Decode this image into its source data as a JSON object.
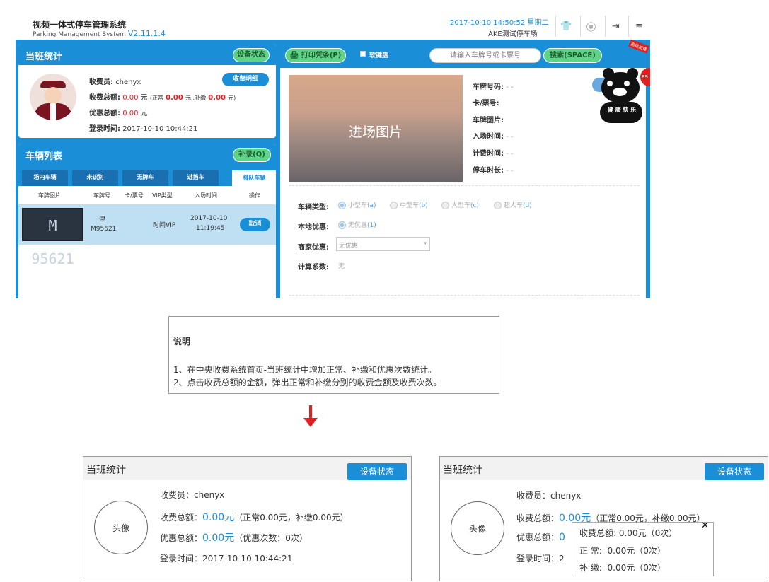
{
  "header": {
    "title": "视频一体式停车管理系统",
    "subtitle": "Parking Management System",
    "version": "V2.11.1.4",
    "datetime": "2017-10-10 14:50:52 星期二",
    "lot_name": "AKE测试停车场"
  },
  "shift_panel": {
    "title": "当班统计",
    "device_status_btn": "设备状态",
    "cashier_label": "收费员:",
    "cashier_value": "chenyx",
    "detail_btn": "收费明细",
    "total_label": "收费总额:",
    "total_value": "0.00",
    "yuan": "元",
    "normal_prefix": "(正常",
    "normal_value": "0.00",
    "normal_unit": "元 ,补缴",
    "supp_value": "0.00",
    "supp_suffix": "元)",
    "discount_label": "优惠总额:",
    "discount_value": "0.00",
    "login_label": "登录时间:",
    "login_value": "2017-10-10 10:44:21"
  },
  "vehicle_list": {
    "title": "车辆列表",
    "supplement_btn": "补录(Q)",
    "tabs": [
      "场内车辆",
      "未识别",
      "无牌车",
      "进挡车",
      "排队车辆"
    ],
    "columns": [
      "车牌图片",
      "车牌号",
      "卡/票号",
      "VIP类型",
      "入场时间",
      "操作"
    ],
    "rows": [
      {
        "plate_img_text": "M 95621",
        "plate_prov": "津",
        "plate_no": "M95621",
        "card": "",
        "vip": "时间VIP",
        "date": "2017-10-10",
        "time": "11:19:45",
        "action": "取消"
      }
    ]
  },
  "toolbar": {
    "print_btn": "打印凭条(P)",
    "soft_keyboard": "软键盘",
    "search_placeholder": "请输入车牌号或卡票号",
    "search_btn": "搜索(SPACE)",
    "corner_badge": "高级加速",
    "speed_badge": "89"
  },
  "entry": {
    "image_label": "进场图片",
    "fields": [
      {
        "label": "车牌号码:",
        "value": "- -"
      },
      {
        "label": "卡/票号:",
        "value": ""
      },
      {
        "label": "车牌图片:",
        "value": ""
      },
      {
        "label": "入场时间:",
        "value": "- -"
      },
      {
        "label": "计费时间:",
        "value": "- -"
      },
      {
        "label": "停车时长:",
        "value": "- -"
      }
    ],
    "vehicle_type_label": "车辆类型:",
    "vehicle_types": [
      {
        "name": "小型车",
        "key": "(a)"
      },
      {
        "name": "中型车",
        "key": "(b)"
      },
      {
        "name": "大型车",
        "key": "(c)"
      },
      {
        "name": "超大车",
        "key": "(d)"
      }
    ],
    "local_discount_label": "本地优惠:",
    "local_discount_option": "无优惠",
    "local_discount_key": "(1)",
    "merchant_label": "商家优惠:",
    "merchant_value": "无优惠",
    "coeff_label": "计算系数:",
    "coeff_value": "无",
    "mascot_text": "健 康 快 乐"
  },
  "note": {
    "title": "说明",
    "line1": "1、在中央收费系统首页-当班统计中增加正常、补缴和优惠次数统计。",
    "line2": "2、点击收费总额的金额，弹出正常和补缴分别的收费金额及收费次数。"
  },
  "mock_left": {
    "title": "当班统计",
    "btn": "设备状态",
    "avatar": "头像",
    "cashier": "收费员：chenyx",
    "total_label": "收费总额：",
    "total_amt": "0.00元",
    "total_detail": "（正常0.00元，补缴0.00元）",
    "discount_label": "优惠总额：",
    "discount_amt": "0.00元",
    "discount_detail": "（优惠次数：0次）",
    "login": "登录时间：2017-10-10  10:44:21"
  },
  "mock_right": {
    "title": "当班统计",
    "btn": "设备状态",
    "avatar": "头像",
    "cashier": "收费员：chenyx",
    "total_label": "收费总额：",
    "total_amt": "0.00元",
    "total_detail": "（正常0.00元，补缴0.00元）",
    "discount_label": "优惠总额：",
    "discount_amt": "0",
    "login_partial": "登录时间：2",
    "popup": {
      "close": "✕",
      "line1": "收费总额:   0.00元（0次）",
      "line2_label": "正      常:",
      "line2_value": "0.00元（0次）",
      "line3_label": "补      缴:",
      "line3_value": "0.00元（0次）"
    }
  },
  "colors": {
    "accent": "#1a8fd8",
    "green": "#5fd38a",
    "red": "#e02020"
  }
}
